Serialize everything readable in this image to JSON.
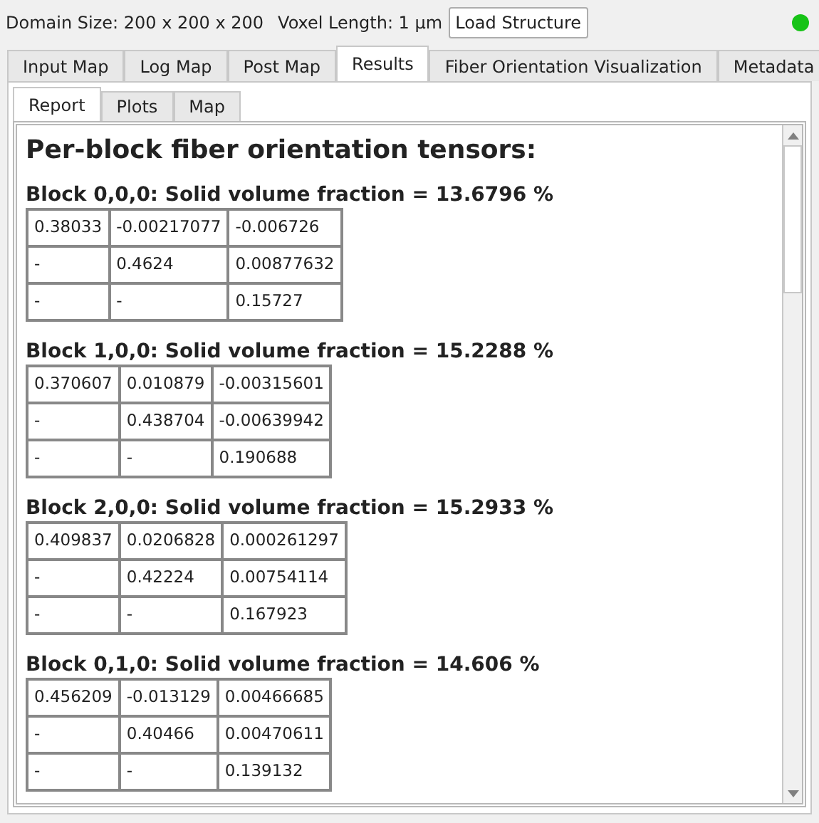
{
  "toolbar": {
    "domain_size": "Domain Size: 200 x 200 x 200",
    "voxel_length": "Voxel Length: 1 µm",
    "load_button": "Load Structure",
    "status_indicator": {
      "on": true
    }
  },
  "tabs": [
    {
      "label": "Input Map",
      "selected": false
    },
    {
      "label": "Log Map",
      "selected": false
    },
    {
      "label": "Post Map",
      "selected": false
    },
    {
      "label": "Results",
      "selected": true
    },
    {
      "label": "Fiber Orientation Visualization",
      "selected": false
    },
    {
      "label": "Metadata",
      "selected": false
    }
  ],
  "subtabs": [
    {
      "label": "Report",
      "selected": true
    },
    {
      "label": "Plots",
      "selected": false
    },
    {
      "label": "Map",
      "selected": false
    }
  ],
  "report": {
    "title": "Per-block fiber orientation tensors:",
    "blocks": [
      {
        "heading": "Block 0,0,0: Solid volume fraction = 13.6796 %",
        "rows": [
          [
            "0.38033",
            "-0.00217077",
            "-0.006726"
          ],
          [
            "-",
            "0.4624",
            "0.00877632"
          ],
          [
            "-",
            "-",
            "0.15727"
          ]
        ]
      },
      {
        "heading": "Block 1,0,0: Solid volume fraction = 15.2288 %",
        "rows": [
          [
            "0.370607",
            "0.010879",
            "-0.00315601"
          ],
          [
            "-",
            "0.438704",
            "-0.00639942"
          ],
          [
            "-",
            "-",
            "0.190688"
          ]
        ]
      },
      {
        "heading": "Block 2,0,0: Solid volume fraction = 15.2933 %",
        "rows": [
          [
            "0.409837",
            "0.0206828",
            "0.000261297"
          ],
          [
            "-",
            "0.42224",
            "0.00754114"
          ],
          [
            "-",
            "-",
            "0.167923"
          ]
        ]
      },
      {
        "heading": "Block 0,1,0: Solid volume fraction = 14.606 %",
        "rows": [
          [
            "0.456209",
            "-0.013129",
            "0.00466685"
          ],
          [
            "-",
            "0.40466",
            "0.00470611"
          ],
          [
            "-",
            "-",
            "0.139132"
          ]
        ]
      }
    ]
  }
}
